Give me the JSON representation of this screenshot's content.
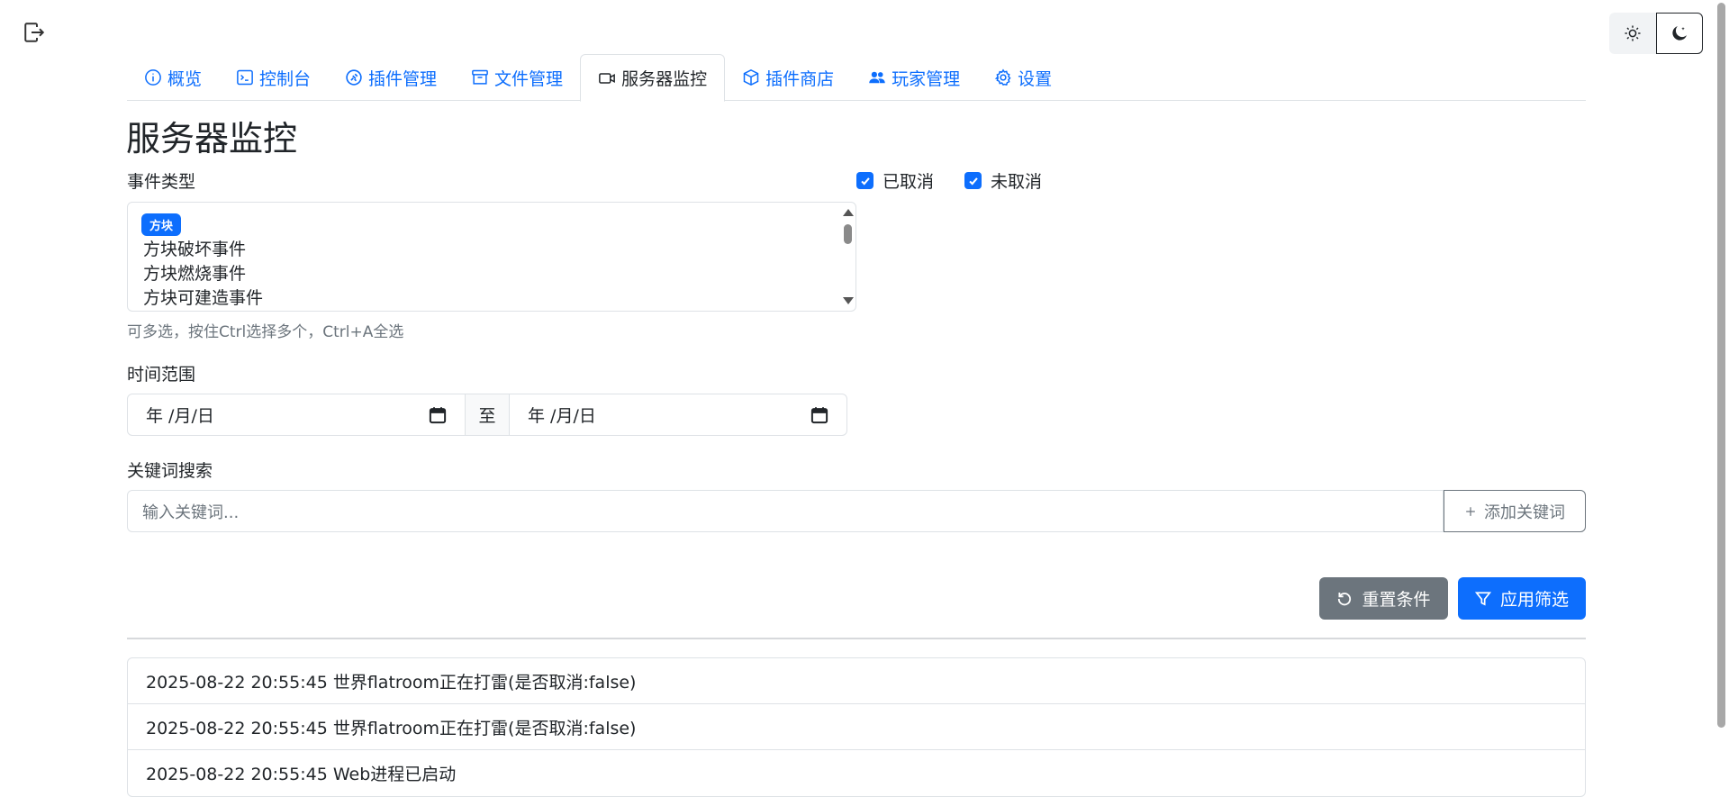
{
  "header": {
    "logout_icon": "logout-icon",
    "theme": {
      "light_icon": "sun-icon",
      "dark_icon": "moon-icon"
    }
  },
  "tabs": [
    {
      "label": "概览",
      "icon": "info-circle-icon",
      "active": false
    },
    {
      "label": "控制台",
      "icon": "terminal-icon",
      "active": false
    },
    {
      "label": "插件管理",
      "icon": "plugin-icon",
      "active": false
    },
    {
      "label": "文件管理",
      "icon": "archive-icon",
      "active": false
    },
    {
      "label": "服务器监控",
      "icon": "camera-video-icon",
      "active": true
    },
    {
      "label": "插件商店",
      "icon": "box-icon",
      "active": false
    },
    {
      "label": "玩家管理",
      "icon": "people-icon",
      "active": false
    },
    {
      "label": "设置",
      "icon": "gear-icon",
      "active": false
    }
  ],
  "page": {
    "title": "服务器监控"
  },
  "filters": {
    "event_type_label": "事件类型",
    "cancelled_label": "已取消",
    "not_cancelled_label": "未取消",
    "cancelled_checked": true,
    "not_cancelled_checked": true,
    "event_group_badge": "方块",
    "events": [
      "方块破坏事件",
      "方块燃烧事件",
      "方块可建造事件"
    ],
    "multi_select_hint": "可多选，按住Ctrl选择多个，Ctrl+A全选",
    "time_range_label": "时间范围",
    "date_start_placeholder": "年 /月/日",
    "date_separator": "至",
    "date_end_placeholder": "年 /月/日",
    "keyword_label": "关键词搜索",
    "keyword_placeholder": "输入关键词...",
    "add_keyword_label": "添加关键词",
    "reset_label": "重置条件",
    "apply_label": "应用筛选"
  },
  "logs": [
    "2025-08-22 20:55:45 世界flatroom正在打雷(是否取消:false)",
    "2025-08-22 20:55:45 世界flatroom正在打雷(是否取消:false)",
    "2025-08-22 20:55:45 Web进程已启动"
  ],
  "colors": {
    "primary": "#0d6efd",
    "secondary": "#6c757d",
    "border": "#dee2e6"
  }
}
